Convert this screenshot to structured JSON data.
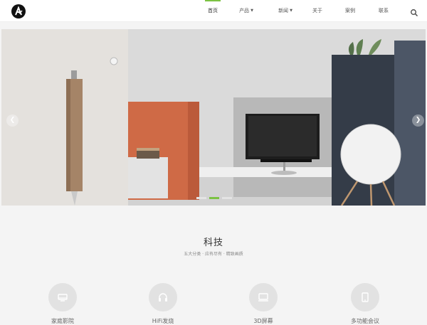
{
  "header": {
    "nav": [
      {
        "label": "首页",
        "active": true
      },
      {
        "label": "产品",
        "dropdown": true
      },
      {
        "label": "新闻",
        "dropdown": true
      },
      {
        "label": "关于"
      },
      {
        "label": "案例"
      },
      {
        "label": "联系"
      }
    ]
  },
  "banner": {
    "slide_count": 3,
    "active_slide": 2
  },
  "section": {
    "title": "科技",
    "subtitle": "五大分类 · 应有尽有 · 精致画质",
    "features": [
      {
        "label": "家庭影院",
        "icon": "home-theater-icon"
      },
      {
        "label": "HiFi发烧",
        "icon": "headphones-icon"
      },
      {
        "label": "3D屏幕",
        "icon": "monitor-icon"
      },
      {
        "label": "多功能会议",
        "icon": "tablet-icon"
      }
    ]
  },
  "colors": {
    "accent": "#7cc243",
    "background": "#f4f4f4"
  }
}
